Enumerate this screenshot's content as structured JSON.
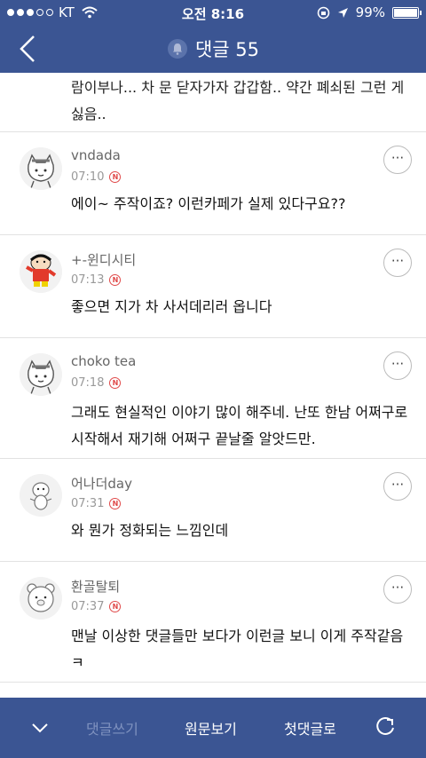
{
  "status_bar": {
    "carrier": "KT",
    "time": "오전 8:16",
    "battery": "99%",
    "battery_level": 0.99
  },
  "header": {
    "title": "댓글 55",
    "icons": {
      "back": "back-arrow-icon",
      "bell": "bell-icon"
    }
  },
  "fragment": {
    "text": "람이부나... 차 문 닫자가자 갑갑함.. 약간 폐쇠된 그런 게 싫음.."
  },
  "comments": [
    {
      "user": "vndada",
      "time": "07:10",
      "text": "에이~ 주작이죠? 이런카페가 실제 있다구요??",
      "avatar": "cat-sketch-avatar"
    },
    {
      "user": "+-윈디시티",
      "time": "07:13",
      "text": "좋으면 지가 차 사서데리러 옵니다",
      "avatar": "shinchan-avatar"
    },
    {
      "user": "choko tea",
      "time": "07:18",
      "text": "그래도 현실적인 이야기 많이 해주네.  난또 한남 어쩌구로 시작해서 재기해 어쩌구 끝날줄 알앗드만.",
      "avatar": "cat-sketch-avatar"
    },
    {
      "user": "어나더day",
      "time": "07:31",
      "text": "와 뭔가 정화되는 느낌인데",
      "avatar": "blob-avatar"
    },
    {
      "user": "환골탈퇴",
      "time": "07:37",
      "text": "맨날 이상한 댓글들만 보다가 이런글 보니 이게 주작같음ㅋ",
      "avatar": "bear-avatar"
    }
  ],
  "new_badge": "N",
  "more_label": "···",
  "footer": {
    "write": "댓글쓰기",
    "view_original": "원문보기",
    "first_comment": "첫댓글로",
    "icons": {
      "collapse": "chevron-down-icon",
      "refresh": "refresh-icon"
    }
  },
  "colors": {
    "brand": "#3b5593",
    "new_badge": "#e04a4a"
  }
}
